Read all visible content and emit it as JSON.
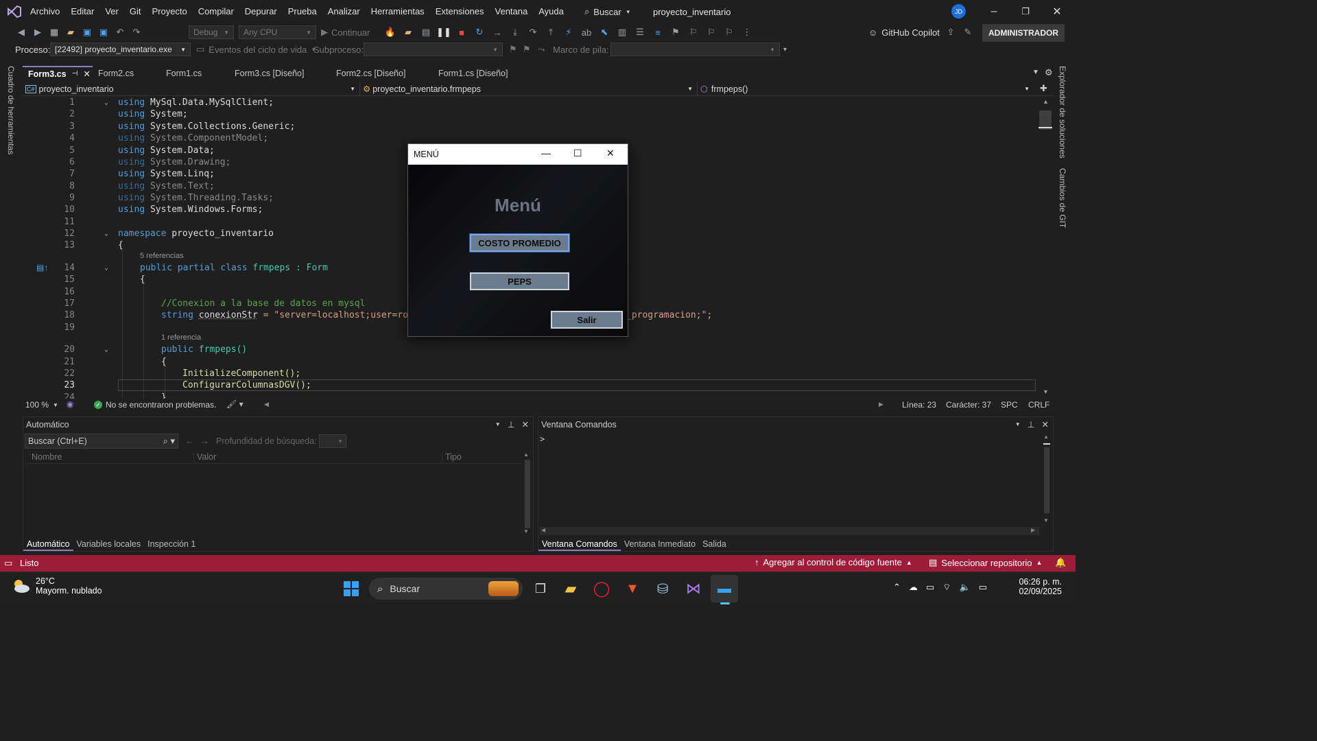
{
  "colors": {
    "accent": "#8e7cc3",
    "status_bar": "#9d1c3a",
    "keyword": "#569cd6",
    "type": "#4ec9b0",
    "string": "#d69d85",
    "comment": "#57a64a",
    "method": "#dcdcaa",
    "dialog_button": "#6b7a8c"
  },
  "menubar": {
    "items": [
      "Archivo",
      "Editar",
      "Ver",
      "Git",
      "Proyecto",
      "Compilar",
      "Depurar",
      "Prueba",
      "Analizar",
      "Herramientas",
      "Extensiones",
      "Ventana",
      "Ayuda"
    ],
    "search_label": "Buscar",
    "solution_name": "proyecto_inventario",
    "avatar_initials": "JD"
  },
  "toolbar": {
    "config": "Debug",
    "platform": "Any CPU",
    "continue_label": "Continuar",
    "copilot_label": "GitHub Copilot",
    "admin_label": "ADMINISTRADOR"
  },
  "procbar": {
    "process_label": "Proceso:",
    "process_value": "[22492] proyecto_inventario.exe",
    "lifecycle_label": "Eventos del ciclo de vida",
    "thread_label": "Subproceso:",
    "stack_label": "Marco de pila:"
  },
  "side": {
    "left": "Cuadro de herramientas",
    "right_1": "Explorador de soluciones",
    "right_2": "Cambios de GIT"
  },
  "tabs": [
    "Form3.cs",
    "Form2.cs",
    "Form1.cs",
    "Form3.cs [Diseño]",
    "Form2.cs [Diseño]",
    "Form1.cs [Diseño]"
  ],
  "navbar": {
    "project": "proyecto_inventario",
    "class": "proyecto_inventario.frmpeps",
    "member": "frmpeps()"
  },
  "editor": {
    "line_numbers": [
      "1",
      "2",
      "3",
      "4",
      "5",
      "6",
      "7",
      "8",
      "9",
      "10",
      "11",
      "12",
      "13",
      "14",
      "15",
      "16",
      "17",
      "18",
      "19",
      "20",
      "21",
      "22",
      "23",
      "24"
    ],
    "refs": [
      "5 referencias",
      "1 referencia"
    ],
    "code": {
      "l1": "MySql.Data.MySqlClient;",
      "l2": "System;",
      "l3": "System.Collections.Generic;",
      "l4": "System.ComponentModel;",
      "l5": "System.Data;",
      "l6": "System.Drawing;",
      "l7": "System.Linq;",
      "l8": "System.Text;",
      "l9": "System.Threading.Tasks;",
      "l10": "System.Windows.Forms;",
      "using_kw": "using",
      "ns_kw": "namespace",
      "ns_name": "proyecto_inventario",
      "brace_open": "{",
      "class_decl_kw": "public partial class",
      "class_name": "frmpeps",
      "class_base": ": Form",
      "comment": "//Conexion a la base de datos en mysql",
      "string_kw": "string",
      "var_name": "conexionStr",
      "str_start": "= \"server=localhost;user=ro",
      "str_end": "_programacion;\";",
      "ctor_kw": "public",
      "ctor_name": "frmpeps()",
      "call1": "InitializeComponent();",
      "call2": "ConfigurarColumnasDGV();",
      "brace_close": "}"
    }
  },
  "edstatus": {
    "zoom": "100 %",
    "problems": "No se encontraron problemas.",
    "line": "Línea: 23",
    "char": "Carácter: 37",
    "spc": "SPC",
    "eol": "CRLF"
  },
  "autos": {
    "title": "Automático",
    "search_placeholder": "Buscar (Ctrl+E)",
    "depth_label": "Profundidad de búsqueda:",
    "columns": [
      "Nombre",
      "Valor",
      "Tipo"
    ],
    "tabs": [
      "Automático",
      "Variables locales",
      "Inspección 1"
    ]
  },
  "commands": {
    "title": "Ventana Comandos",
    "prompt": ">",
    "tabs": [
      "Ventana Comandos",
      "Ventana Inmediato",
      "Salida"
    ]
  },
  "statusbar": {
    "ready": "Listo",
    "source_control": "Agregar al control de código fuente",
    "repo": "Seleccionar repositorio"
  },
  "taskbar": {
    "weather_temp": "26°C",
    "weather_desc": "Mayorm. nublado",
    "search": "Buscar",
    "time": "06:26 p. m.",
    "date": "02/09/2025"
  },
  "dialog": {
    "title": "MENÚ",
    "heading": "Menú",
    "btn_avg": "COSTO PROMEDIO",
    "btn_peps": "PEPS",
    "btn_exit": "Salir"
  }
}
